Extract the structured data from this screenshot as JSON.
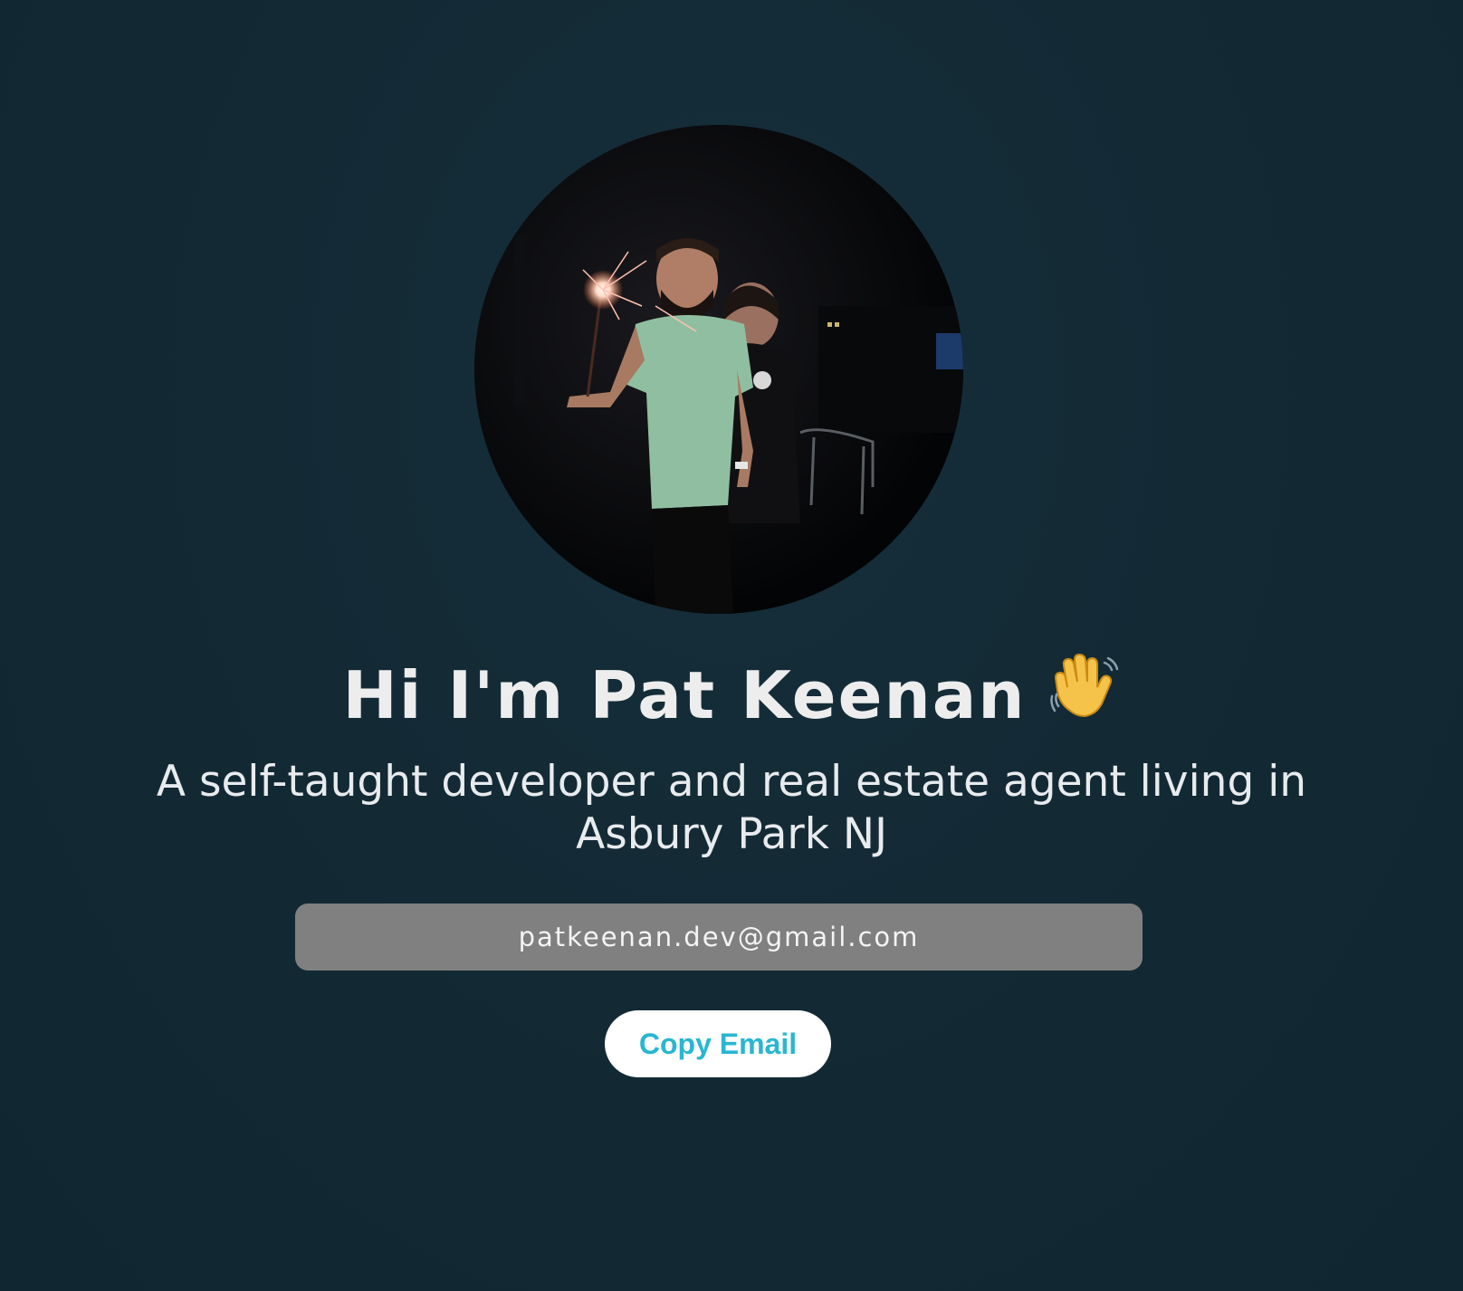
{
  "hero": {
    "headline": "Hi I'm Pat Keenan",
    "headline_icon": "waving-hand-icon",
    "subtitle": "A self-taught developer and real estate agent living in Asbury Park NJ",
    "email": "patkeenan.dev@gmail.com",
    "copy_button_label": "Copy Email"
  },
  "colors": {
    "background": "#132a35",
    "headline_text": "#ededee",
    "email_field_bg": "#808080",
    "button_bg": "#ffffff",
    "button_text": "#29b6d2"
  }
}
